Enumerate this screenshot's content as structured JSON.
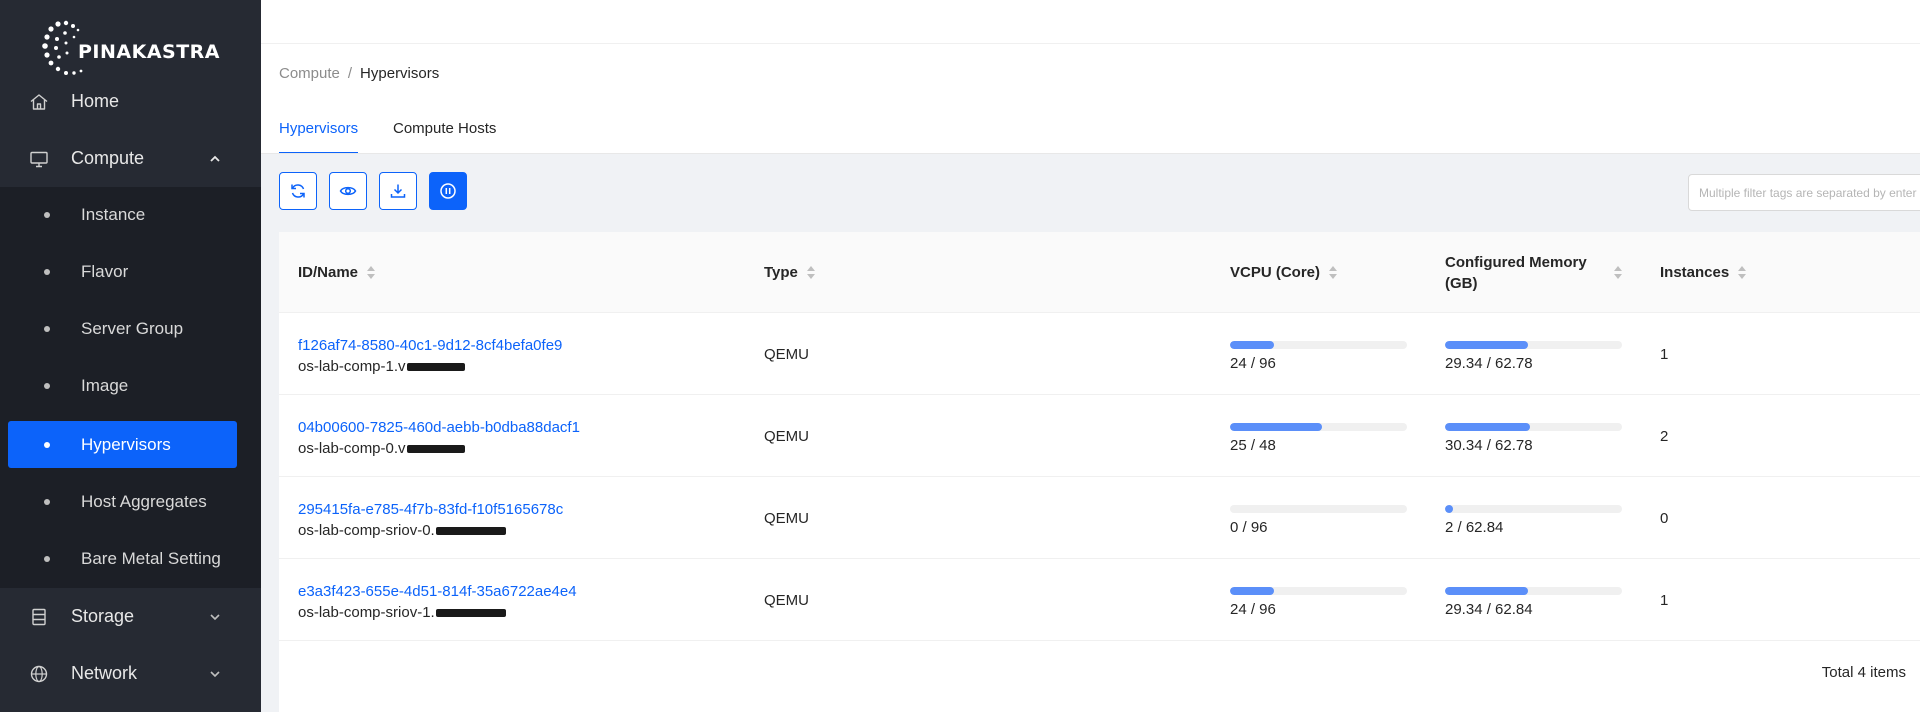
{
  "sidebar": {
    "brand": "PINAKASTRA",
    "top_items": [
      {
        "label": "Home",
        "icon": "home-icon"
      },
      {
        "label": "Compute",
        "icon": "monitor-icon"
      },
      {
        "label": "Storage",
        "icon": "storage-icon"
      },
      {
        "label": "Network",
        "icon": "globe-icon"
      }
    ],
    "compute_sub_items": [
      {
        "label": "Instance"
      },
      {
        "label": "Flavor"
      },
      {
        "label": "Server Group"
      },
      {
        "label": "Image"
      },
      {
        "label": "Hypervisors",
        "active": true
      },
      {
        "label": "Host Aggregates"
      },
      {
        "label": "Bare Metal Setting"
      }
    ]
  },
  "breadcrumb": {
    "parent": "Compute",
    "separator": "/",
    "current": "Hypervisors"
  },
  "tabs": [
    {
      "label": "Hypervisors",
      "active": true
    },
    {
      "label": "Compute Hosts",
      "active": false
    }
  ],
  "toolbar": {
    "buttons": [
      "refresh-icon",
      "eye-icon",
      "download-icon",
      "pause-icon"
    ],
    "search_placeholder": "Multiple filter tags are separated by enter"
  },
  "table": {
    "columns": [
      "ID/Name",
      "Type",
      "VCPU (Core)",
      "Configured Memory (GB)",
      "Instances"
    ],
    "rows": [
      {
        "id": "f126af74-8580-40c1-9d12-8cf4befa0fe9",
        "name": "os-lab-comp-1.v",
        "type": "QEMU",
        "vcpu_label": "24 / 96",
        "vcpu_pct": 25,
        "mem_label": "29.34 / 62.78",
        "mem_pct": 46.7,
        "instances": "1"
      },
      {
        "id": "04b00600-7825-460d-aebb-b0dba88dacf1",
        "name": "os-lab-comp-0.v",
        "type": "QEMU",
        "vcpu_label": "25 / 48",
        "vcpu_pct": 52,
        "mem_label": "30.34 / 62.78",
        "mem_pct": 48.3,
        "instances": "2"
      },
      {
        "id": "295415fa-e785-4f7b-83fd-f10f5165678c",
        "name": "os-lab-comp-sriov-0.",
        "type": "QEMU",
        "vcpu_label": "0 / 96",
        "vcpu_pct": 0,
        "mem_label": "2 / 62.84",
        "mem_pct": 3.2,
        "instances": "0"
      },
      {
        "id": "e3a3f423-655e-4d51-814f-35a6722ae4e4",
        "name": "os-lab-comp-sriov-1.",
        "type": "QEMU",
        "vcpu_label": "24 / 96",
        "vcpu_pct": 25,
        "mem_label": "29.34 / 62.84",
        "mem_pct": 46.7,
        "instances": "1"
      }
    ],
    "total": "Total 4 items"
  },
  "colors": {
    "accent": "#0c63fa",
    "sidebar_bg": "#262a33",
    "submenu_bg": "#1c1f26",
    "progress": "#5b8ff9"
  }
}
